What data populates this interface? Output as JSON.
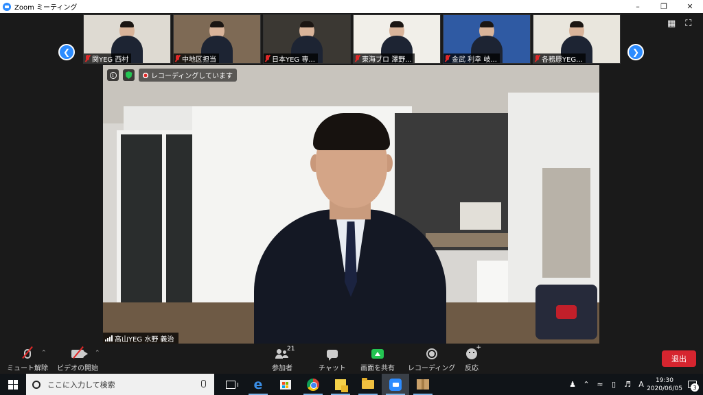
{
  "window": {
    "title": "Zoom ミーティング",
    "icon": "zoom-app-icon",
    "controls": [
      "minimize",
      "restore",
      "close"
    ]
  },
  "gallery": {
    "thumbnails": [
      {
        "name": "関YEG 西村",
        "muted": true,
        "bg": "#dedad2",
        "accent": "#ffffff"
      },
      {
        "name": "中地区担当",
        "muted": true,
        "bg": "#7e6a55",
        "accent": "#b89b77"
      },
      {
        "name": "日本YEG 専...",
        "muted": true,
        "bg": "#3b3833",
        "accent": "#9c8f7c"
      },
      {
        "name": "東海ブロ 澤野...",
        "muted": true,
        "bg": "#f1efe9",
        "accent": "#2a2f45"
      },
      {
        "name": "金武 利幸 岐...",
        "muted": true,
        "bg": "#2f5aa3",
        "accent": "#ffffff"
      },
      {
        "name": "各務原YEG...",
        "muted": true,
        "bg": "#e9e6dd",
        "accent": "#c9c2b1"
      }
    ],
    "icons": [
      "chevron-left-icon",
      "chevron-right-icon",
      "gallery-view-icon",
      "fullscreen-icon"
    ]
  },
  "main_video": {
    "name": "高山YEG 水野 義治",
    "recording_text": "レコーディングしています"
  },
  "toolbar": {
    "unmute": "ミュート解除",
    "start_video": "ビデオの開始",
    "participants": "参加者",
    "participants_count": "21",
    "chat": "チャット",
    "share_screen": "画面を共有",
    "record": "レコーディング",
    "reactions": "反応",
    "leave": "退出"
  },
  "taskbar": {
    "search_placeholder": "ここに入力して検索",
    "apps": [
      "task-view-icon",
      "edge-icon",
      "store-icon",
      "chrome-icon",
      "sticky-notes-icon",
      "file-explorer-icon",
      "zoom-icon",
      "package-icon"
    ],
    "time": "19:30",
    "date": "2020/06/05",
    "ime": "A",
    "notifications": "3"
  },
  "colors": {
    "zoom_blue": "#2D8CFF",
    "leave_red": "#D6252F",
    "share_green": "#23C552",
    "toolbar_bg": "#1A1A1A"
  }
}
